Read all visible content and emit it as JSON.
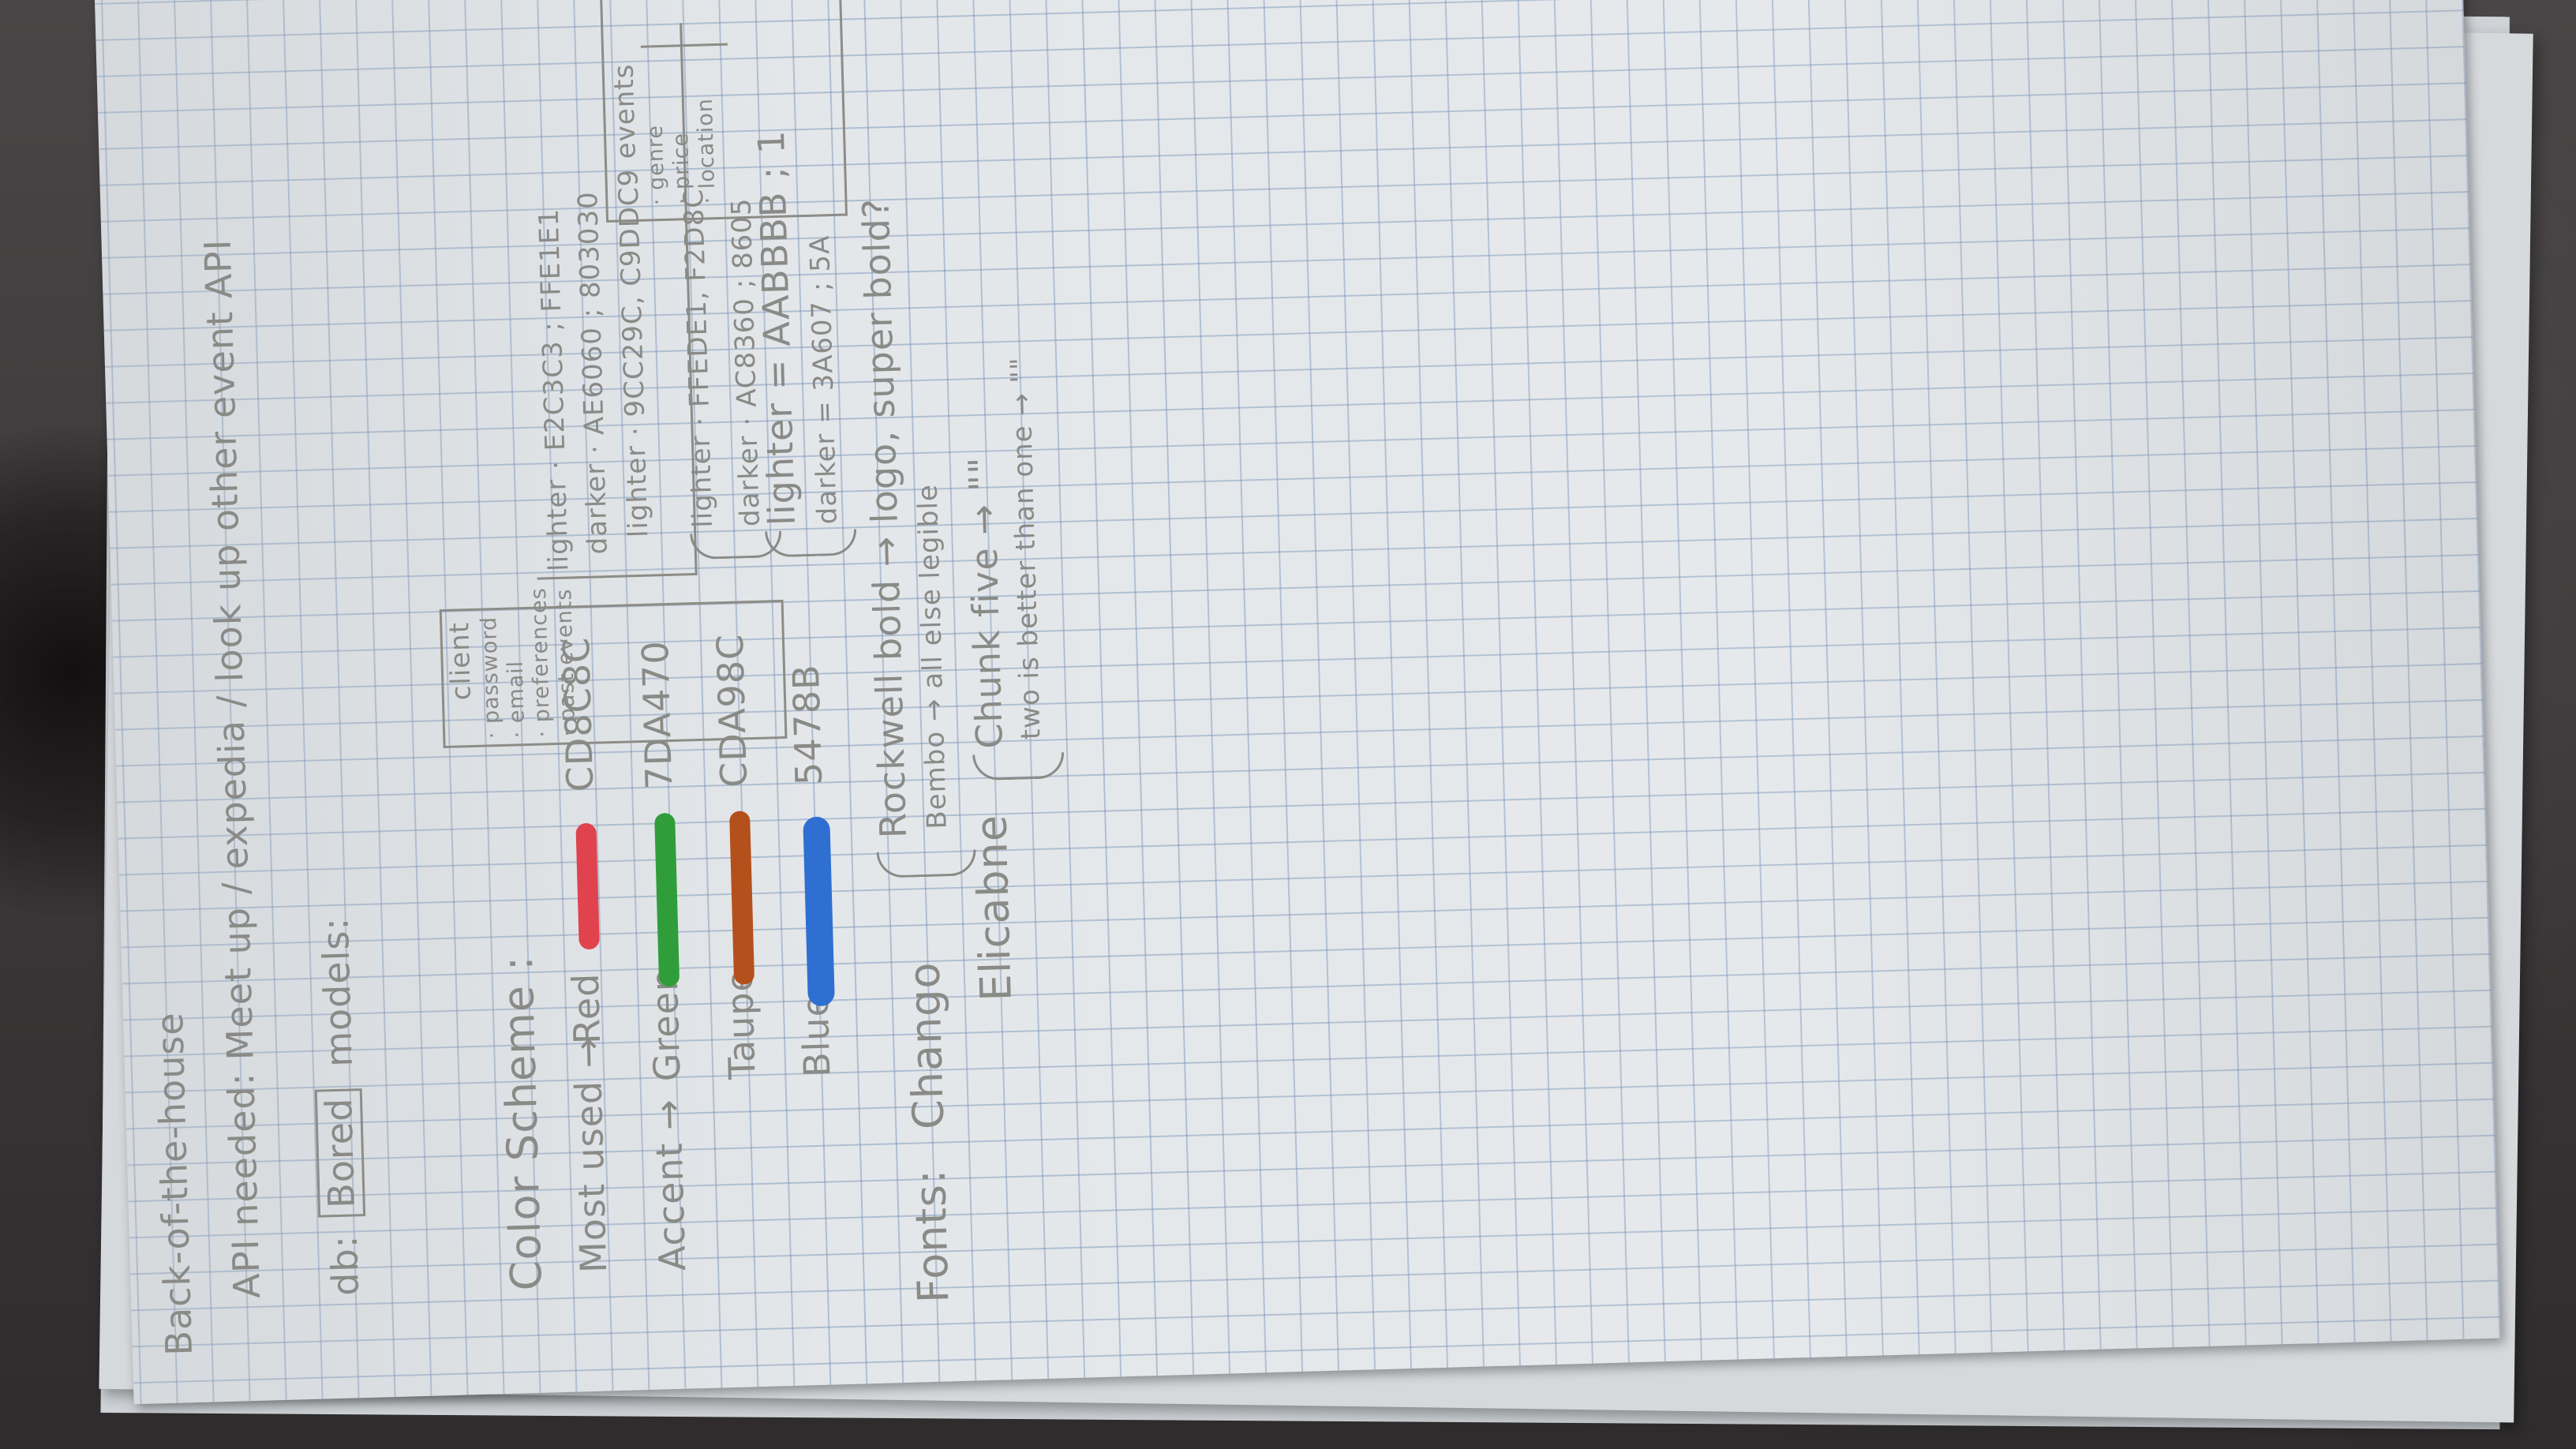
{
  "title": "Back-of-the-house",
  "api_note": "API needed: Meet up / expedia / look up other event API",
  "db": {
    "label": "db:",
    "boxed": "Bored",
    "models_label": "models:"
  },
  "client_model": {
    "title": "client",
    "fields": [
      "· password",
      "· email",
      "· preferences",
      "· past events"
    ]
  },
  "events_model": {
    "title": "events",
    "fields": [
      "· genre",
      "· price",
      "· location"
    ]
  },
  "color_scheme": {
    "heading": "Color Scheme :",
    "rows": [
      {
        "label": "Most used →",
        "name": "Red",
        "hex": "CD8C8C",
        "lighter": "lighter · E2C3C3 ; FFE1E1",
        "darker": "darker · AE6060 ; 803030",
        "color": "#e0434d"
      },
      {
        "label": "Accent →",
        "name": "Green",
        "hex": "7DA470",
        "lighter": "lighter · 9CC29C, C9DDC9",
        "darker": "",
        "color": "#2f9e3a"
      },
      {
        "label": "",
        "name": "Taupe",
        "hex": "CDA98C",
        "lighter": "lighter · FFEDE1, F2D8C",
        "darker": "darker · AC8360 ; 8605",
        "color": "#b4501c"
      },
      {
        "label": "",
        "name": "Blue",
        "hex": "5478B",
        "lighter": "lighter = AABBBB ; 1",
        "darker": "darker = 3A607 ; 5A",
        "color": "#2f6fd1"
      }
    ]
  },
  "fonts": {
    "label": "Fonts:",
    "primary": "Chango",
    "secondary": "Elicabne",
    "primary_notes": [
      "Rockwell bold → logo, super bold?",
      "Bembo → all else legible"
    ],
    "secondary_notes": [
      "Chunk five → \"\"",
      "two is better than one → \"\""
    ]
  }
}
